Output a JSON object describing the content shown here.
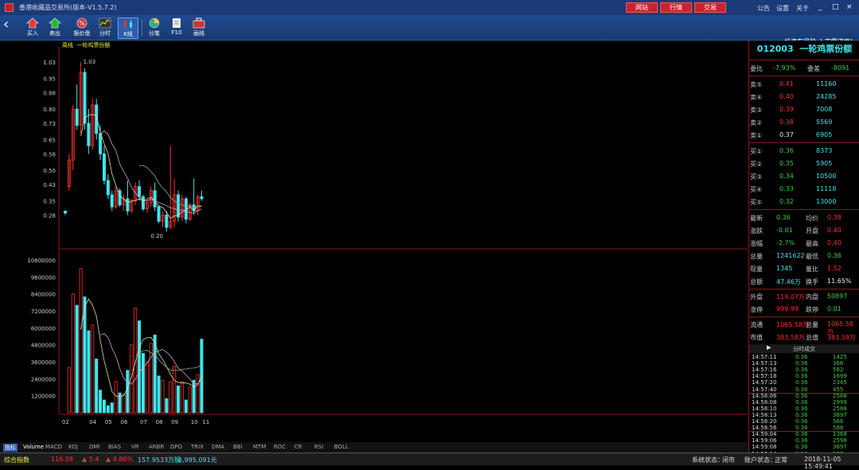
{
  "window": {
    "title": "香港收藏品交易所(版本-V1.5.7.2)",
    "buttons": [
      "网站",
      "行情",
      "交易"
    ],
    "links": [
      "公告",
      "设置",
      "关于"
    ],
    "controls": [
      "_",
      "□",
      "×"
    ]
  },
  "toolbar": {
    "items": [
      "买入",
      "卖出",
      "报价盘",
      "分时",
      "K线",
      "分笔",
      "F10",
      "画线"
    ],
    "selected": "K线",
    "notice": "投资有风险,入市需谨慎!"
  },
  "chart": {
    "label": "周线",
    "name": "一轮鸡票份额",
    "price_max_label": "1.03",
    "price_min_label": "0.20",
    "price_ticks": [
      "1.03",
      "0.95",
      "0.88",
      "0.80",
      "0.73",
      "0.65",
      "0.58",
      "0.50",
      "0.43",
      "0.35",
      "0.28"
    ],
    "vol_ticks": [
      "10800000",
      "9600000",
      "8400000",
      "7200000",
      "6000000",
      "4800000",
      "3600000",
      "2400000",
      "1200000"
    ],
    "x_ticks": [
      "02",
      "04",
      "05",
      "06",
      "07",
      "08",
      "09",
      "10",
      "11"
    ]
  },
  "chart_data": {
    "type": "candlestick",
    "candles": [
      [
        0.3,
        0.3,
        0.28,
        0.29
      ],
      [
        0.42,
        0.58,
        0.4,
        0.55
      ],
      [
        0.55,
        0.82,
        0.5,
        0.8
      ],
      [
        0.8,
        0.92,
        0.7,
        0.72
      ],
      [
        0.72,
        1.03,
        0.68,
        0.98
      ],
      [
        0.98,
        1.0,
        0.7,
        0.73
      ],
      [
        0.73,
        0.8,
        0.58,
        0.62
      ],
      [
        0.62,
        0.85,
        0.6,
        0.82
      ],
      [
        0.82,
        0.85,
        0.65,
        0.68
      ],
      [
        0.68,
        0.72,
        0.55,
        0.58
      ],
      [
        0.58,
        0.62,
        0.43,
        0.45
      ],
      [
        0.45,
        0.48,
        0.36,
        0.38
      ],
      [
        0.38,
        0.4,
        0.3,
        0.32
      ],
      [
        0.32,
        0.42,
        0.31,
        0.4
      ],
      [
        0.4,
        0.41,
        0.32,
        0.33
      ],
      [
        0.33,
        0.38,
        0.3,
        0.36
      ],
      [
        0.36,
        0.45,
        0.28,
        0.3
      ],
      [
        0.3,
        0.36,
        0.29,
        0.35
      ],
      [
        0.35,
        0.44,
        0.33,
        0.42
      ],
      [
        0.42,
        0.45,
        0.35,
        0.37
      ],
      [
        0.37,
        0.38,
        0.3,
        0.31
      ],
      [
        0.31,
        0.35,
        0.29,
        0.34
      ],
      [
        0.34,
        0.42,
        0.32,
        0.4
      ],
      [
        0.4,
        0.44,
        0.3,
        0.32
      ],
      [
        0.32,
        0.33,
        0.24,
        0.25
      ],
      [
        0.25,
        0.3,
        0.22,
        0.28
      ],
      [
        0.28,
        0.3,
        0.2,
        0.22
      ],
      [
        0.22,
        0.62,
        0.21,
        0.25
      ],
      [
        0.25,
        0.46,
        0.22,
        0.38
      ],
      [
        0.38,
        0.4,
        0.25,
        0.27
      ],
      [
        0.27,
        0.38,
        0.25,
        0.36
      ],
      [
        0.36,
        0.37,
        0.24,
        0.26
      ],
      [
        0.26,
        0.34,
        0.25,
        0.33
      ],
      [
        0.33,
        0.46,
        0.28,
        0.3
      ],
      [
        0.3,
        0.38,
        0.28,
        0.37
      ],
      [
        0.37,
        0.4,
        0.35,
        0.36
      ]
    ],
    "volumes": [
      0,
      3200000,
      8400000,
      7600000,
      10200000,
      8200000,
      5800000,
      6200000,
      3800000,
      1600000,
      900000,
      500000,
      700000,
      2200000,
      1400000,
      1300000,
      3000000,
      4800000,
      7400000,
      6500000,
      4200000,
      3600000,
      4900000,
      5500000,
      2600000,
      2300000,
      1000000,
      2200000,
      3300000,
      1900000,
      2200000,
      900000,
      1800000,
      2300000,
      2700000,
      5200000
    ]
  },
  "quote": {
    "code": "012003",
    "name": "一轮鸡票份额",
    "wb": [
      "委比",
      "-7.93%",
      "委差",
      "-8091"
    ],
    "asks": [
      [
        "卖⑤",
        "0.41",
        "11160"
      ],
      [
        "卖④",
        "0.40",
        "24285"
      ],
      [
        "卖③",
        "0.39",
        "7008"
      ],
      [
        "卖②",
        "0.38",
        "5569"
      ],
      [
        "卖①",
        "0.37",
        "6905"
      ]
    ],
    "bids": [
      [
        "买①",
        "0.36",
        "8373"
      ],
      [
        "买②",
        "0.35",
        "5905"
      ],
      [
        "买③",
        "0.34",
        "10500"
      ],
      [
        "买④",
        "0.33",
        "11118"
      ],
      [
        "买⑤",
        "0.32",
        "13000"
      ]
    ],
    "stats": [
      [
        "最新",
        "0.36",
        "均价",
        "0.38"
      ],
      [
        "涨跌",
        "-0.01",
        "开盘",
        "0.40"
      ],
      [
        "涨幅",
        "-2.7%",
        "最高",
        "0.40"
      ],
      [
        "总量",
        "1241622",
        "最低",
        "0.36"
      ],
      [
        "现量",
        "1345",
        "量比",
        "1.52"
      ],
      [
        "总额",
        "47.46万",
        "换手",
        "11.65%"
      ],
      [
        "外盘",
        "119.07万",
        "内盘",
        "50897"
      ],
      [
        "涨停",
        "999.99",
        "跌停",
        "0.01"
      ],
      [
        "流通",
        "1065.58万",
        "总量",
        "1065.58万"
      ],
      [
        "市值",
        "383.58万",
        "总值",
        "383.58万"
      ]
    ],
    "trades_title": "分时成交",
    "trades": [
      [
        "14:57:11",
        "0.36",
        "1425"
      ],
      [
        "14:57:13",
        "0.36",
        "366"
      ],
      [
        "14:57:16",
        "0.36",
        "582"
      ],
      [
        "14:57:18",
        "0.36",
        "1699"
      ],
      [
        "14:57:20",
        "0.36",
        "2345"
      ],
      [
        "14:57:40",
        "0.36",
        "455"
      ],
      [
        "14:58:06",
        "0.36",
        "2588"
      ],
      [
        "14:58:08",
        "0.36",
        "2999"
      ],
      [
        "14:58:10",
        "0.36",
        "2588"
      ],
      [
        "14:58:13",
        "0.36",
        "3697"
      ],
      [
        "14:58:20",
        "0.36",
        "566"
      ],
      [
        "14:58:56",
        "0.36",
        "588"
      ],
      [
        "14:59:04",
        "0.36",
        "1368"
      ],
      [
        "14:59:06",
        "0.36",
        "2598"
      ],
      [
        "14:59:08",
        "0.36",
        "3697"
      ],
      [
        "14:59:14",
        "0.36",
        "577"
      ],
      [
        "14:59:17",
        "0.36",
        "1345"
      ]
    ]
  },
  "tabs": [
    "指标",
    "Volume",
    "MACD",
    "KDJ",
    "DMI",
    "BIAS",
    "VR",
    "ARBR",
    "DPO",
    "TRIX",
    "DMA",
    "BBI",
    "MTM",
    "ROC",
    "CR",
    "RSI",
    "BOLL"
  ],
  "status": {
    "index_label": "综合指数",
    "index_value": "116.58",
    "change": "▲ 5.4",
    "pct": "▲ 4.86%",
    "volume": "157.9533万股",
    "amount": "6,995,091元",
    "sys_label": "系统状态：",
    "sys_value": "闭市",
    "acct_label": "账户状态：",
    "acct_value": "正常",
    "datetime": "2018-11-05 15:49:41"
  },
  "colors": {
    "up": "#ff3030",
    "down": "#3ee6ee",
    "ma5": "#e0e0a0",
    "ma10": "#d0a0d0",
    "ma20": "#8ab48a"
  }
}
